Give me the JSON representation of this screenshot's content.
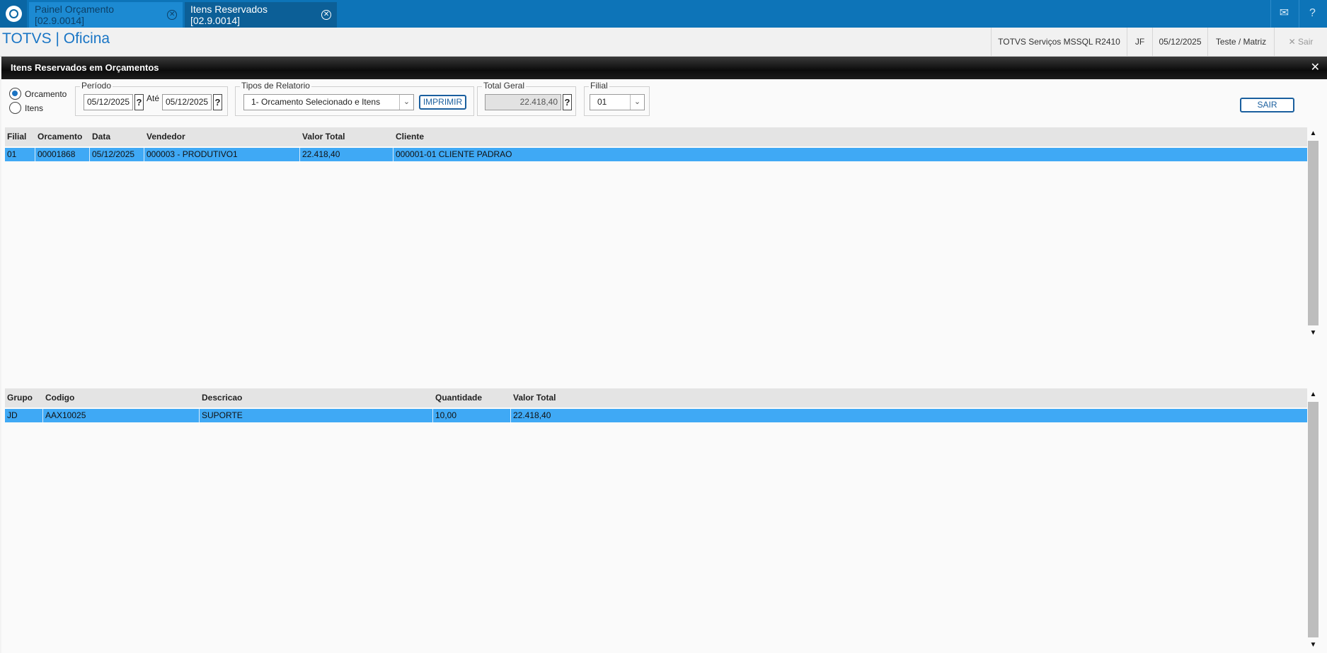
{
  "tabs": [
    {
      "label": "Painel Orçamento [02.9.0014]"
    },
    {
      "label": "Itens Reservados [02.9.0014]"
    }
  ],
  "topbar_icons": [
    "mail-icon",
    "help-icon"
  ],
  "header": {
    "app_title": "TOTVS | Oficina",
    "environment": "TOTVS Serviços MSSQL R2410",
    "user": "JF",
    "date": "05/12/2025",
    "company": "Teste / Matriz",
    "exit_label": "Sair"
  },
  "panel": {
    "title": "Itens Reservados em Orçamentos",
    "radio": {
      "orcamento": "Orcamento",
      "itens": "Itens",
      "selected": "Orcamento"
    },
    "periodo": {
      "legend": "Período",
      "from": "05/12/2025",
      "ate_label": "Até",
      "to": "05/12/2025",
      "help": "?"
    },
    "tipos": {
      "legend": "Tipos de Relatorio",
      "selected": "1- Orcamento Selecionado e Itens",
      "print_label": "IMPRIMIR"
    },
    "total": {
      "legend": "Total Geral",
      "value": "22.418,40",
      "help": "?"
    },
    "filial": {
      "legend": "Filial",
      "selected": "01"
    },
    "sair_label": "SAIR"
  },
  "orcamentos_grid": {
    "columns": [
      "Filial",
      "Orcamento",
      "Data",
      "Vendedor",
      "Valor Total",
      "Cliente"
    ],
    "rows": [
      [
        "01",
        "00001868",
        "05/12/2025",
        " 000003 - PRODUTIVO1",
        "22.418,40",
        "000001-01 CLIENTE PADRAO"
      ]
    ]
  },
  "itens_grid": {
    "columns": [
      "Grupo",
      "Codigo",
      "Descricao",
      "Quantidade",
      "Valor Total"
    ],
    "rows": [
      [
        "JD",
        "AAX10025",
        "SUPORTE",
        "10,00",
        "22.418,40"
      ]
    ]
  },
  "colors": {
    "topbar": "#0d74b8",
    "selected_row": "#3fa9f5",
    "title_blue": "#1975c5"
  }
}
